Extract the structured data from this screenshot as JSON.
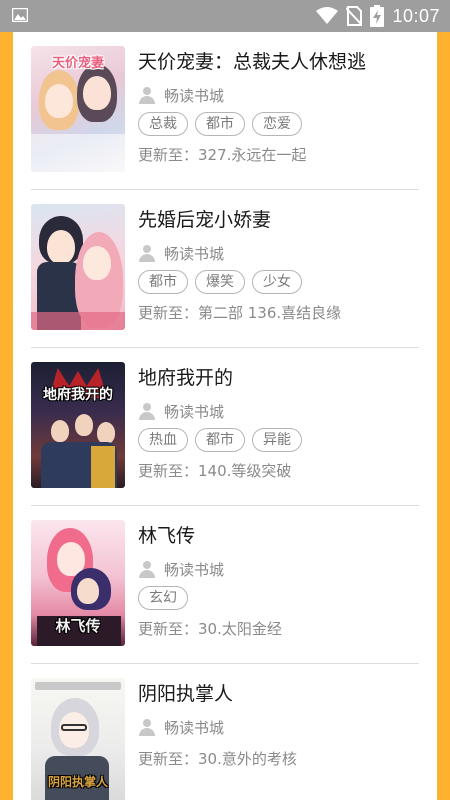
{
  "status_bar": {
    "time": "10:07",
    "icons": [
      "image-icon",
      "wifi-icon",
      "no-sim-icon",
      "battery-charging-icon"
    ]
  },
  "colors": {
    "status_bar": "#9e9e9e",
    "frame": "#ffb22e",
    "title": "#1a1a1a",
    "meta": "#8a8a8a",
    "tag_border": "#b5b5b5"
  },
  "books": [
    {
      "title": "天价宠妻：总裁夫人休想逃",
      "author": "畅读书城",
      "tags": [
        "总裁",
        "都市",
        "恋爱"
      ],
      "update": "更新至：327.永远在一起",
      "cover_text": "天价宠妻"
    },
    {
      "title": "先婚后宠小娇妻",
      "author": "畅读书城",
      "tags": [
        "都市",
        "爆笑",
        "少女"
      ],
      "update": "更新至：第二部 136.喜结良缘",
      "cover_text": ""
    },
    {
      "title": "地府我开的",
      "author": "畅读书城",
      "tags": [
        "热血",
        "都市",
        "异能"
      ],
      "update": "更新至：140.等级突破",
      "cover_text": "地府我开的"
    },
    {
      "title": "林飞传",
      "author": "畅读书城",
      "tags": [
        "玄幻"
      ],
      "update": "更新至：30.太阳金经",
      "cover_text": "林飞传"
    },
    {
      "title": "阴阳执掌人",
      "author": "畅读书城",
      "tags": [],
      "update": "更新至：30.意外的考核",
      "cover_text": "阴阳执掌人"
    }
  ]
}
